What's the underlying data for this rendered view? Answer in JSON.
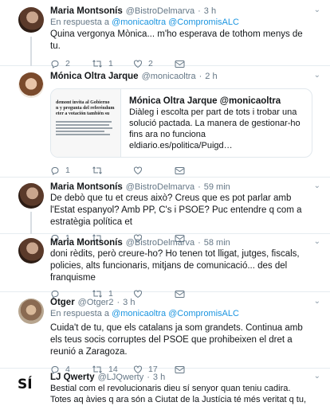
{
  "tweets": [
    {
      "name": "Maria Montsonís",
      "handle": "@BistroDelmarva",
      "time": "3 h",
      "reply_prefix": "En respuesta a",
      "reply_to": "@monicaoltra @CompromisALC",
      "text": "Quina vergonya Mònica... m'ho esperava de tothom menys de tu.",
      "replies": "2",
      "retweets": "1",
      "likes": "2"
    },
    {
      "name": "Mónica Oltra Jarque",
      "handle": "@monicaoltra",
      "time": "2 h",
      "card": {
        "title": "Mónica Oltra Jarque @monicaoltra",
        "desc": "Diàleg i escolta per part de tots i trobar una solució pactada. La manera de gestionar-ho fins ara no funciona eldiario.es/politica/Puigd…",
        "thumb_lines": [
          "demont invita al Gobierno",
          "n y pregunta del referéndum",
          "eter a votación también su"
        ]
      },
      "replies": "1",
      "retweets": "",
      "likes": ""
    },
    {
      "name": "Maria Montsonís",
      "handle": "@BistroDelmarva",
      "time": "59 min",
      "text": "De debò que tu et creus això? Creus que es pot parlar amb l'Estat espanyol? Amb PP, C's i PSOE? Puc entendre q com a estratègia política et",
      "replies": "1",
      "retweets": "",
      "likes": ""
    },
    {
      "name": "Maria Montsonís",
      "handle": "@BistroDelmarva",
      "time": "58 min",
      "text": "doni rèdits, però creure-ho? Ho tenen tot lligat, jutges, fiscals, policies, alts funcionaris, mitjans de comunicació... des del franquisme",
      "replies": "",
      "retweets": "1",
      "likes": ""
    },
    {
      "name": "Otger",
      "handle": "@Otger2",
      "time": "3 h",
      "reply_prefix": "En respuesta a",
      "reply_to": "@monicaoltra @CompromisALC",
      "text": "Cuida't de tu, que els catalans ja som grandets. Continua amb els teus socis corruptes del PSOE que prohibeixen el dret a reunió a Zaragoza.",
      "replies": "4",
      "retweets": "14",
      "likes": "17"
    },
    {
      "name": "LJ Qwerty",
      "handle": "@LJQwerty",
      "time": "3 h",
      "avatar_text": "SÍ",
      "text": "Bestial com el revolucionaris dieu sí senyor quan teniu cadira. Totes aq àvies q ara són a Ciutat de la Justícia té més veritat q tu, Mònica"
    }
  ],
  "separator": "·",
  "colors": {
    "link": "#1b95e0",
    "muted": "#657786",
    "thread": "#d8dee3"
  },
  "icons": [
    "reply-icon",
    "retweet-icon",
    "like-icon",
    "dm-icon",
    "chevron-down-icon"
  ]
}
